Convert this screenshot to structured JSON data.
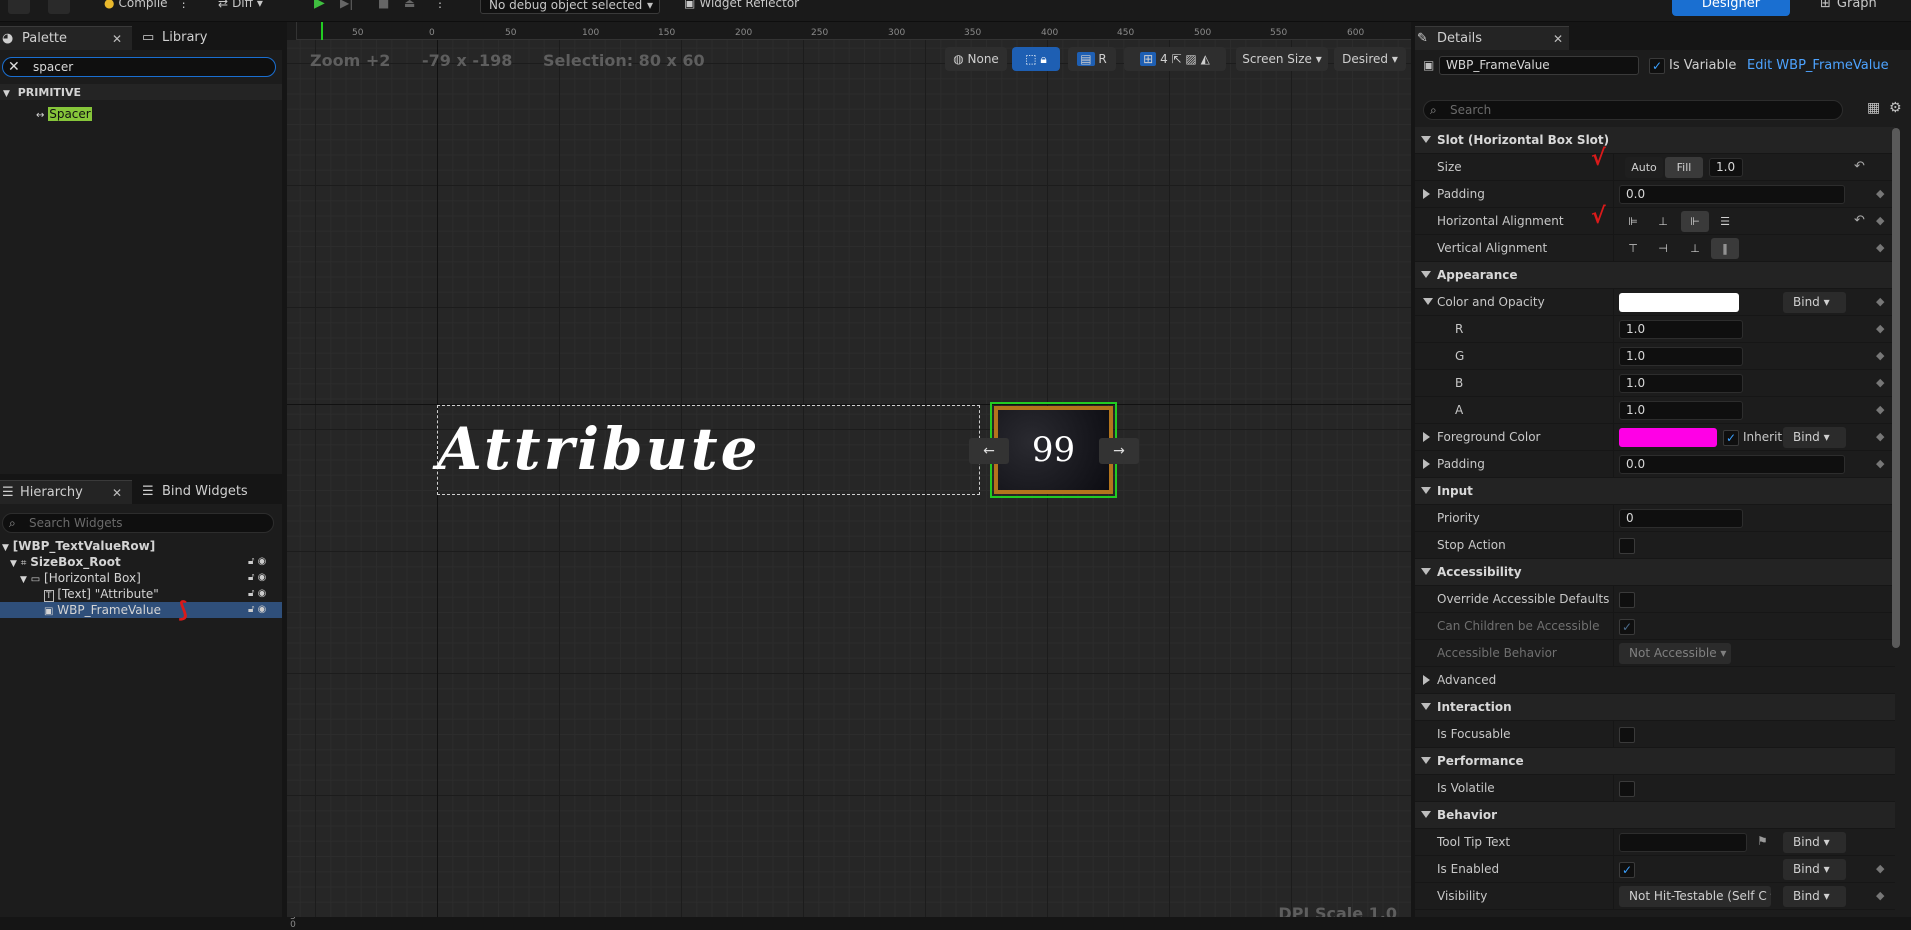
{
  "toolbar": {
    "compile_label": "Compile",
    "diff_label": "Diff",
    "debug_select": "No debug object selected",
    "widget_reflector": "Widget Reflector",
    "designer_label": "Designer",
    "graph_label": "Graph"
  },
  "palette": {
    "tab_label": "Palette",
    "library_tab_label": "Library",
    "search_value": "spacer",
    "category": "PRIMITIVE",
    "item": "Spacer"
  },
  "hierarchy": {
    "tab_label": "Hierarchy",
    "bind_tab_label": "Bind Widgets",
    "search_placeholder": "Search Widgets",
    "rows": [
      {
        "label": "[WBP_TextValueRow]"
      },
      {
        "label": "SizeBox_Root"
      },
      {
        "label": "[Horizontal Box]"
      },
      {
        "label": "[Text] \"Attribute\""
      },
      {
        "label": "WBP_FrameValue"
      }
    ]
  },
  "canvas": {
    "zoom": "Zoom +2",
    "coords": "-79 x -198",
    "selection": "Selection: 80 x 60",
    "none_label": "None",
    "r_label": "R",
    "grid_num": "4",
    "screen_size": "Screen Size",
    "desired": "Desired",
    "attribute_text": "Attribute",
    "frame_value": "99",
    "dpi": "DPI Scale 1.0",
    "ruler_top": [
      "50",
      "0",
      "50",
      "100",
      "150",
      "200",
      "250",
      "300",
      "350",
      "400",
      "450",
      "500",
      "550",
      "600"
    ],
    "ruler_left": [
      "2\n0\n0",
      "0",
      "1\n5\n0",
      "1\n0\n0",
      "5\n0",
      "0",
      "5\n0",
      "1\n0\n0",
      "1\n5\n0",
      "2\n0\n0",
      "2\n5\n0",
      "3\n0\n0",
      "3\n5\n0"
    ]
  },
  "details": {
    "tab_label": "Details",
    "name_value": "WBP_FrameValue",
    "is_variable_label": "Is Variable",
    "edit_link": "Edit WBP_FrameValue",
    "search_placeholder": "Search",
    "slot_section": "Slot (Horizontal Box Slot)",
    "size_label": "Size",
    "size_auto": "Auto",
    "size_fill": "Fill",
    "size_value": "1.0",
    "padding_label": "Padding",
    "padding_value": "0.0",
    "halign_label": "Horizontal Alignment",
    "valign_label": "Vertical Alignment",
    "appearance_section": "Appearance",
    "color_opacity_label": "Color and Opacity",
    "bind_label": "Bind",
    "r_label": "R",
    "r_value": "1.0",
    "g_label": "G",
    "g_value": "1.0",
    "b_label": "B",
    "b_value": "1.0",
    "a_label": "A",
    "a_value": "1.0",
    "fg_label": "Foreground Color",
    "inherit_label": "Inherit",
    "padding2_label": "Padding",
    "padding2_value": "0.0",
    "input_section": "Input",
    "priority_label": "Priority",
    "priority_value": "0",
    "stop_action_label": "Stop Action",
    "accessibility_section": "Accessibility",
    "override_label": "Override Accessible Defaults",
    "children_label": "Can Children be Accessible",
    "behavior_acc_label": "Accessible Behavior",
    "not_accessible": "Not Accessible",
    "advanced_label": "Advanced",
    "interaction_section": "Interaction",
    "focusable_label": "Is Focusable",
    "performance_section": "Performance",
    "volatile_label": "Is Volatile",
    "behavior_section": "Behavior",
    "tooltip_label": "Tool Tip Text",
    "enabled_label": "Is Enabled",
    "visibility_label": "Visibility",
    "visibility_value": "Not Hit-Testable (Self C"
  },
  "colors": {
    "color_opacity": "#ffffff",
    "foreground": "#ff00e6",
    "accent": "#1a6fd1",
    "selection_green": "#22cc22"
  }
}
